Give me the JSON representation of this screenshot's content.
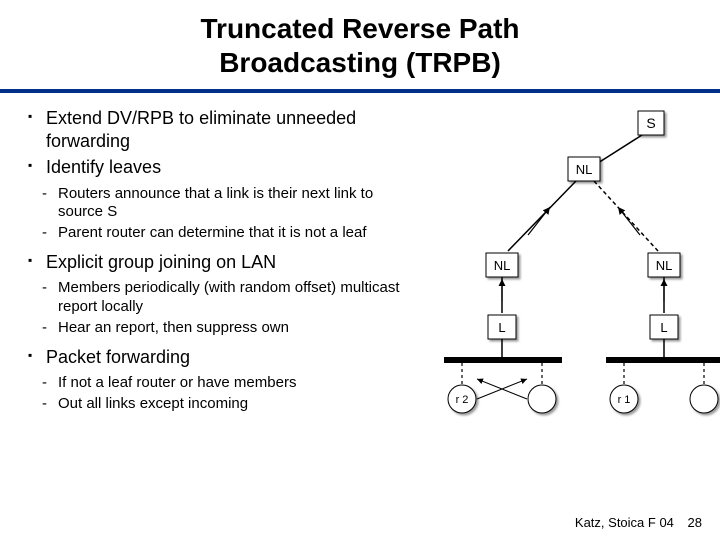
{
  "title": {
    "line1": "Truncated Reverse Path",
    "line2": "Broadcasting (TRPB)"
  },
  "bullets": {
    "b1": "Extend DV/RPB to eliminate unneeded forwarding",
    "b2": "Identify leaves",
    "b2a": "Routers announce that a link is their next link to source S",
    "b2b": "Parent router can determine that it is not a leaf",
    "b3": "Explicit group joining on LAN",
    "b3a": "Members periodically (with random offset) multicast report locally",
    "b3b": "Hear an report, then suppress own",
    "b4": "Packet forwarding",
    "b4a": "If not a leaf router or have members",
    "b4b": "Out all links except incoming"
  },
  "diagram": {
    "S": "S",
    "NL_top": "NL",
    "NL_left": "NL",
    "NL_right": "NL",
    "L_left": "L",
    "L_right": "L",
    "r2": "r 2",
    "r1": "r 1"
  },
  "footer": {
    "credit": "Katz, Stoica F 04",
    "page": "28"
  }
}
